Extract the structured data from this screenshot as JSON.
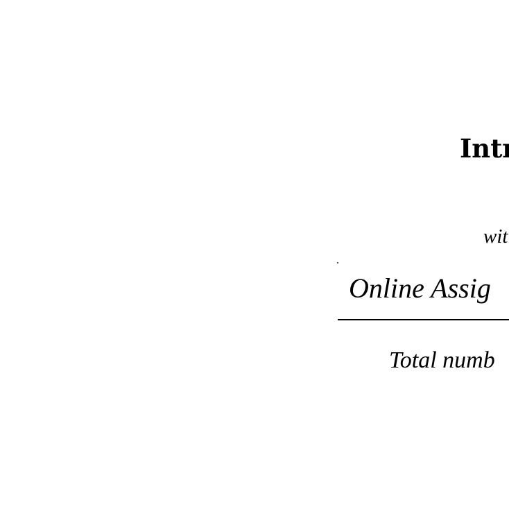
{
  "document": {
    "heading": "Intr",
    "subtitle": "wit",
    "section_title": "Online Assig",
    "total_line": "Total numb"
  }
}
